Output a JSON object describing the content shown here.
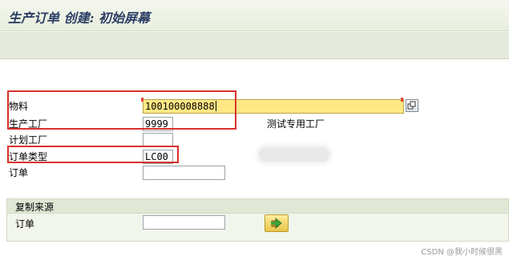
{
  "title": "生产订单 创建: 初始屏幕",
  "fields": {
    "material": {
      "label": "物料",
      "value": "100100008888"
    },
    "plant": {
      "label": "生产工厂",
      "value": "9999",
      "description": "测试专用工厂"
    },
    "planning_plant": {
      "label": "计划工厂",
      "value": ""
    },
    "order_type": {
      "label": "订单类型",
      "value": "LC00"
    },
    "order": {
      "label": "订单",
      "value": ""
    }
  },
  "copy_from": {
    "title": "复制来源",
    "order_label": "订单",
    "order_value": ""
  },
  "icons": {
    "multiple_selection": "multiple-selection-icon",
    "execute": "execute-arrow-icon"
  },
  "colors": {
    "focused_field": "#ffe884",
    "annotation_box": "#d9302c"
  },
  "watermark": "CSDN @我小时候很黑"
}
